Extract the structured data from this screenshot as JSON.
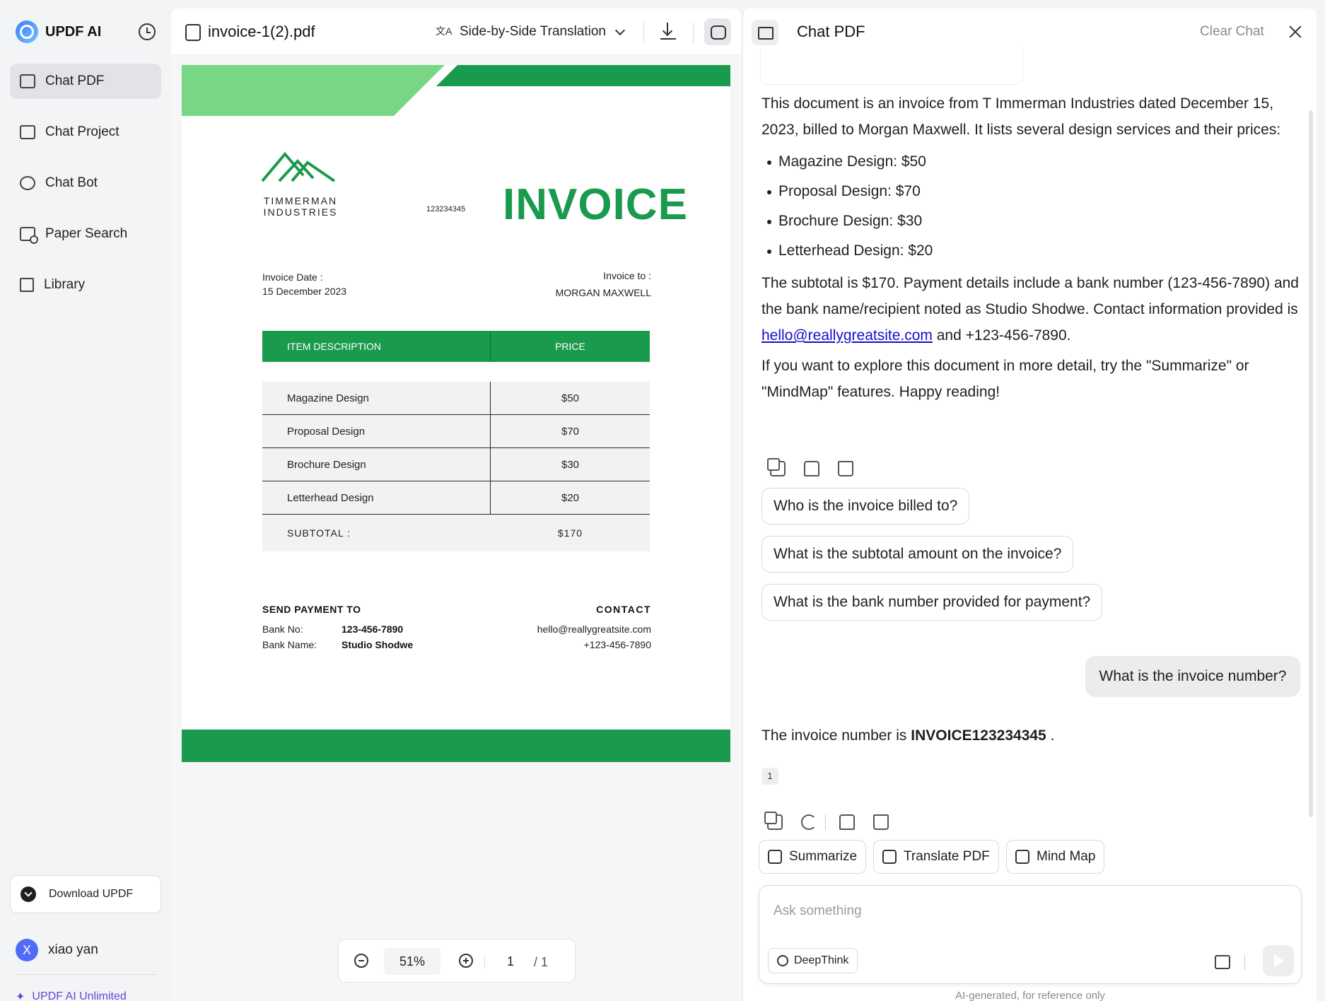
{
  "sidebar": {
    "brand": "UPDF AI",
    "items": [
      {
        "label": "Chat PDF",
        "icon": "chat-pdf-icon",
        "active": true
      },
      {
        "label": "Chat Project",
        "icon": "chat-project-icon"
      },
      {
        "label": "Chat Bot",
        "icon": "chat-bot-icon"
      },
      {
        "label": "Paper Search",
        "icon": "paper-search-icon"
      },
      {
        "label": "Library",
        "icon": "library-icon"
      }
    ],
    "download_label": "Download UPDF",
    "user": {
      "initial": "X",
      "name": "xiao yan"
    },
    "plan": "UPDF AI Unlimited"
  },
  "doc_toolbar": {
    "file_name": "invoice-1(2).pdf",
    "translation_mode": "Side-by-Side Translation"
  },
  "invoice": {
    "company_line1": "TIMMERMAN",
    "company_line2": "INDUSTRIES",
    "number": "123234345",
    "title": "INVOICE",
    "date_label": "Invoice Date :",
    "date_value": "15 December 2023",
    "to_label": "Invoice to :",
    "to_value": "MORGAN MAXWELL",
    "col_item": "ITEM DESCRIPTION",
    "col_price": "PRICE",
    "rows": [
      {
        "item": "Magazine Design",
        "price": "$50"
      },
      {
        "item": "Proposal Design",
        "price": "$70"
      },
      {
        "item": "Brochure Design",
        "price": "$30"
      },
      {
        "item": "Letterhead Design",
        "price": "$20"
      }
    ],
    "subtotal_label": "SUBTOTAL :",
    "subtotal_value": "$170",
    "pay_heading": "SEND PAYMENT TO",
    "bank_no_label": "Bank No:",
    "bank_no_value": "123-456-7890",
    "bank_name_label": "Bank Name:",
    "bank_name_value": "Studio Shodwe",
    "contact_heading": "CONTACT",
    "contact_email": "hello@reallygreatsite.com",
    "contact_phone": "+123-456-7890",
    "colors": {
      "dark_green": "#1a9a4d",
      "light_green": "#79d684"
    }
  },
  "zoom": {
    "level": "51%",
    "page": "1",
    "total": "/ 1"
  },
  "chat": {
    "title": "Chat PDF",
    "clear_label": "Clear Chat",
    "answer1_intro": "This document is an invoice from T Immerman Industries dated December 15, 2023, billed to Morgan Maxwell. It lists several design services and their prices:",
    "answer1_items": [
      "Magazine Design: $50",
      "Proposal Design: $70",
      "Brochure Design: $30",
      "Letterhead Design: $20"
    ],
    "answer1_p2_a": "The subtotal is $170. Payment details include a bank number (123-456-7890) and the bank name/recipient noted as Studio Shodwe. Contact information provided is ",
    "answer1_p2_link": "hello@reallygreatsite.com",
    "answer1_p2_b": " and +123-456-7890.",
    "answer1_p3": "If you want to explore this document in more detail, try the \"Summarize\" or \"MindMap\" features. Happy reading!",
    "suggestions": [
      "Who is the invoice billed to?",
      "What is the subtotal amount on the invoice?",
      "What is the bank number provided for payment?"
    ],
    "user_question": "What is the invoice number?",
    "answer2_a": "The invoice number is ",
    "answer2_bold": "INVOICE123234345",
    "answer2_b": " .",
    "citation": "1",
    "tools": [
      "Summarize",
      "Translate PDF",
      "Mind Map"
    ],
    "input_placeholder": "Ask something",
    "deepthink_label": "DeepThink",
    "disclaimer": "AI-generated, for reference only"
  }
}
